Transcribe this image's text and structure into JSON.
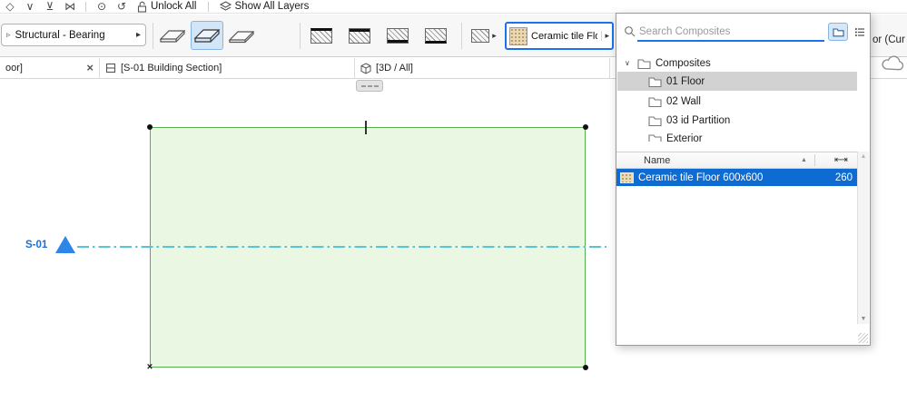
{
  "icons": {
    "diamond": "◇",
    "chevron_down": "∨",
    "align_bottom": "⊻",
    "bowtie": "⋈",
    "target": "⊙",
    "rotate": "↺",
    "favorite_marker": "▹",
    "menu_arrow": "▸",
    "close": "×",
    "x_marker": "×",
    "sort_asc": "▲",
    "scroll_up": "▲",
    "scroll_down": "▼",
    "tree_expanded": "∨",
    "thickness": "⇤⇥"
  },
  "colors": {
    "focus_blue": "#1a73e8",
    "row_selection_blue": "#0d6bd1",
    "tree_selection_gray": "#d2d2d2",
    "slab_fill_green": "#e9f7e3",
    "slab_border_green": "#56b14f",
    "section_line_cyan": "#58c4d8",
    "section_marker_blue": "#2e86e8",
    "section_label_blue": "#1a6fd4"
  },
  "toolbar_top": {
    "unlock_all_label": "Unlock All",
    "show_all_layers_label": "Show All Layers"
  },
  "info_bar": {
    "favorite_label": "Structural - Bearing",
    "composite_label": "Ceramic tile Flo..."
  },
  "tab_bar": {
    "tab_floor_label": "oor]",
    "tab_section_label": "[S-01 Building Section]",
    "tab_3d_label": "[3D / All]"
  },
  "clipped_right_label": "or (Cur",
  "composites_panel": {
    "search_placeholder": "Search Composites",
    "root_label": "Composites",
    "folders": [
      "01 Floor",
      "02 Wall",
      "03 id Partition",
      "Exterior"
    ],
    "selected_folder": "01 Floor",
    "table": {
      "name_header": "Name",
      "row_name": "Ceramic tile Floor 600x600",
      "row_thickness": "260"
    }
  },
  "canvas": {
    "section_label": "S-01"
  }
}
